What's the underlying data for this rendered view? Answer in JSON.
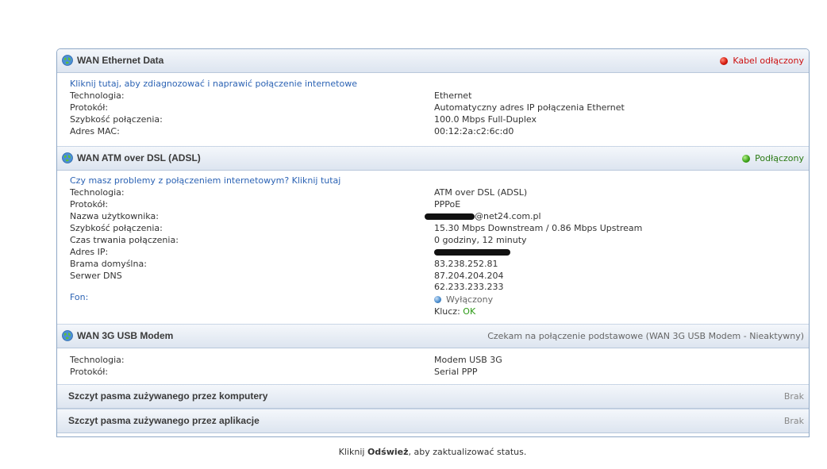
{
  "sections": {
    "eth": {
      "title": "WAN Ethernet Data",
      "status": "Kabel odłączony",
      "link": "Kliknij tutaj, aby zdiagnozować i naprawić połączenie internetowe",
      "labels": [
        "Technologia:",
        "Protokół:",
        "Szybkość połączenia:",
        "Adres MAC:"
      ],
      "values": [
        "Ethernet",
        "Automatyczny adres IP połączenia Ethernet",
        "100.0 Mbps Full-Duplex",
        "00:12:2a:c2:6c:d0"
      ]
    },
    "dsl": {
      "title": "WAN ATM over DSL (ADSL)",
      "status": "Podłączony",
      "link": "Czy masz problemy z połączeniem internetowym? Kliknij tutaj",
      "labels": [
        "Technologia:",
        "Protokół:",
        "Nazwa użytkownika:",
        "Szybkość połączenia:",
        "Czas trwania połączenia:",
        "Adres IP:",
        "Brama domyślna:",
        "Serwer DNS"
      ],
      "values": {
        "technology": "ATM over DSL (ADSL)",
        "protocol": "PPPoE",
        "username_suffix": "@net24.com.pl",
        "speed": "15.30 Mbps Downstream / 0.86 Mbps Upstream",
        "duration": "0 godziny, 12 minuty",
        "gateway": "83.238.252.81",
        "dns1": "87.204.204.204",
        "dns2": "62.233.233.233"
      },
      "fon_label": "Fon:",
      "fon_status": "Wyłączony",
      "key_label": "Klucz:",
      "key_value": "OK"
    },
    "usb3g": {
      "title": "WAN 3G USB Modem",
      "status": "Czekam na połączenie podstawowe (WAN 3G USB Modem - Nieaktywny)",
      "labels": [
        "Technologia:",
        "Protokół:"
      ],
      "values": [
        "Modem USB 3G",
        "Serial PPP"
      ]
    },
    "bw_computers": {
      "title": "Szczyt pasma zużywanego przez komputery",
      "status": "Brak"
    },
    "bw_apps": {
      "title": "Szczyt pasma zużywanego przez aplikacje",
      "status": "Brak"
    }
  },
  "footer": {
    "prefix": "Kliknij ",
    "bold": "Odśwież",
    "suffix": ", aby zaktualizować status."
  },
  "icons": {
    "section": "globe-icon",
    "disconnected": "red-status-dot-icon",
    "connected": "green-status-dot-icon",
    "fon": "blue-status-dot-icon"
  }
}
